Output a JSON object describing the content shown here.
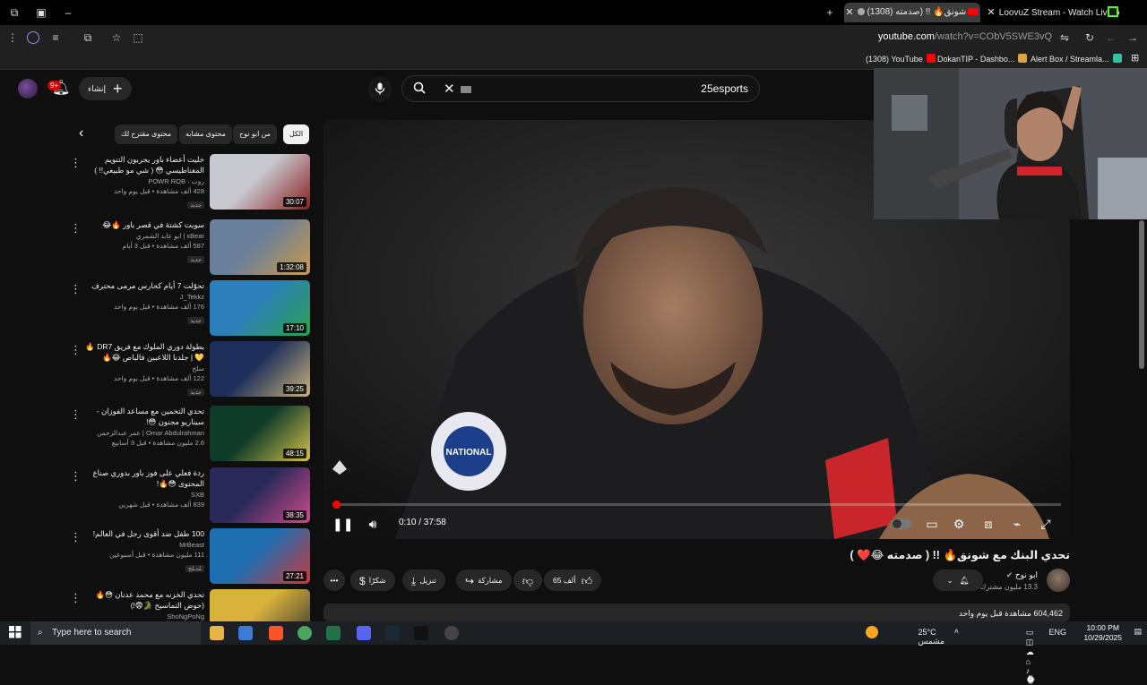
{
  "browser": {
    "tabs": [
      {
        "title": "LoovuZ Stream - Watch Live on",
        "active": false
      },
      {
        "title": "(1308) تحدي البنك مع شونق🔥 !! (صدمته",
        "active": true
      }
    ],
    "url_host": "youtube.com",
    "url_path": "/watch?v=CObV5SWE3vQ",
    "bookmarks": [
      "(1308) YouTube",
      "DokanTIP - Dashbo...",
      "Alert Box / Streamla..."
    ]
  },
  "header": {
    "notification_count": "9+",
    "create_label": "إنشاء",
    "search_value": "25esports"
  },
  "chips": [
    "الكل",
    "من ابو نوح",
    "محتوى مشابه",
    "محتوى مقترح لك"
  ],
  "recommendations": [
    {
      "title": "خليت أعضاء باور يجربون التنويم المغناطيسي 😳 ( شي مو طبيعي!! )",
      "channel": "روب · POWR ROB",
      "meta": "428 ألف مشاهدة • قبل يوم واحد",
      "badge": "جديد",
      "duration": "30:07"
    },
    {
      "title": "سويت كشتة في قصر باور 🔥😂",
      "channel": "xBear | ابو عابد الشمري",
      "meta": "587 ألف مشاهدة • قبل 3 أيام",
      "badge": "جديد",
      "duration": "1:32:08"
    },
    {
      "title": "تحوّلت 7 أيام كحارس مرمى محترف",
      "channel": "J_Tekkz",
      "meta": "176 ألف مشاهدة • قبل يوم واحد",
      "badge": "جديد",
      "duration": "17:10"
    },
    {
      "title": "بطولة دوري الملوك مع فريق DR7 🔥💛 | جلدنا اللاعبين فالباص 😂🔥",
      "channel": "سلخ",
      "meta": "122 ألف مشاهدة • قبل يوم واحد",
      "badge": "جديد",
      "duration": "39:25"
    },
    {
      "title": "تحدي التخمين مع مساعد الفوزان - سيناريو مجنون 😳!",
      "channel": "Omar Abdulrahman | عمر عبدالرحمن",
      "meta": "2.6 مليون مشاهدة • قبل 3 أسابيع",
      "badge": "",
      "duration": "48:15"
    },
    {
      "title": "ردة فعلي على فوز باور بدوري صناع المحتوى 😳🔥!",
      "channel": "SXB",
      "meta": "839 ألف مشاهدة • قبل شهرين",
      "badge": "",
      "duration": "38:35"
    },
    {
      "title": "100 طفل ضد أقوى رجل في العالم!",
      "channel": "MrBeast",
      "meta": "111 مليون مشاهدة • قبل أسبوعين",
      "badge": "مُدبلج",
      "duration": "27:21"
    },
    {
      "title": "تحدي الخزنه مع محمد عدنان 😳🔥 (حوض التماسيح 🐊😨!)",
      "channel": "ShoNgPoNg",
      "meta": "",
      "badge": "",
      "duration": ""
    }
  ],
  "player": {
    "current_time": "0:10",
    "total_time": "37:58",
    "time_display": "0:10 / 37:58",
    "progress_fraction": 0.0044
  },
  "video": {
    "title": "تحدي البنك مع شونق🔥 !! ( صدمته 😂❤️ )",
    "channel_name": "ابو نوح",
    "subscribers": "13.3 مليون مشترك",
    "likes": "65 ألف",
    "share_label": "مشاركة",
    "download_label": "تنزيل",
    "thanks_label": "شكرًا",
    "views_line": "604,462 مشاهدة  قبل يوم واحد"
  },
  "taskbar": {
    "search_placeholder": "Type here to search",
    "weather": "25°C  مشمس",
    "language": "ENG",
    "time": "10:00 PM",
    "date": "10/29/2025"
  },
  "colors": {
    "accent_red": "#ff0000",
    "background": "#0f0f0f",
    "chip_bg": "#272727"
  }
}
